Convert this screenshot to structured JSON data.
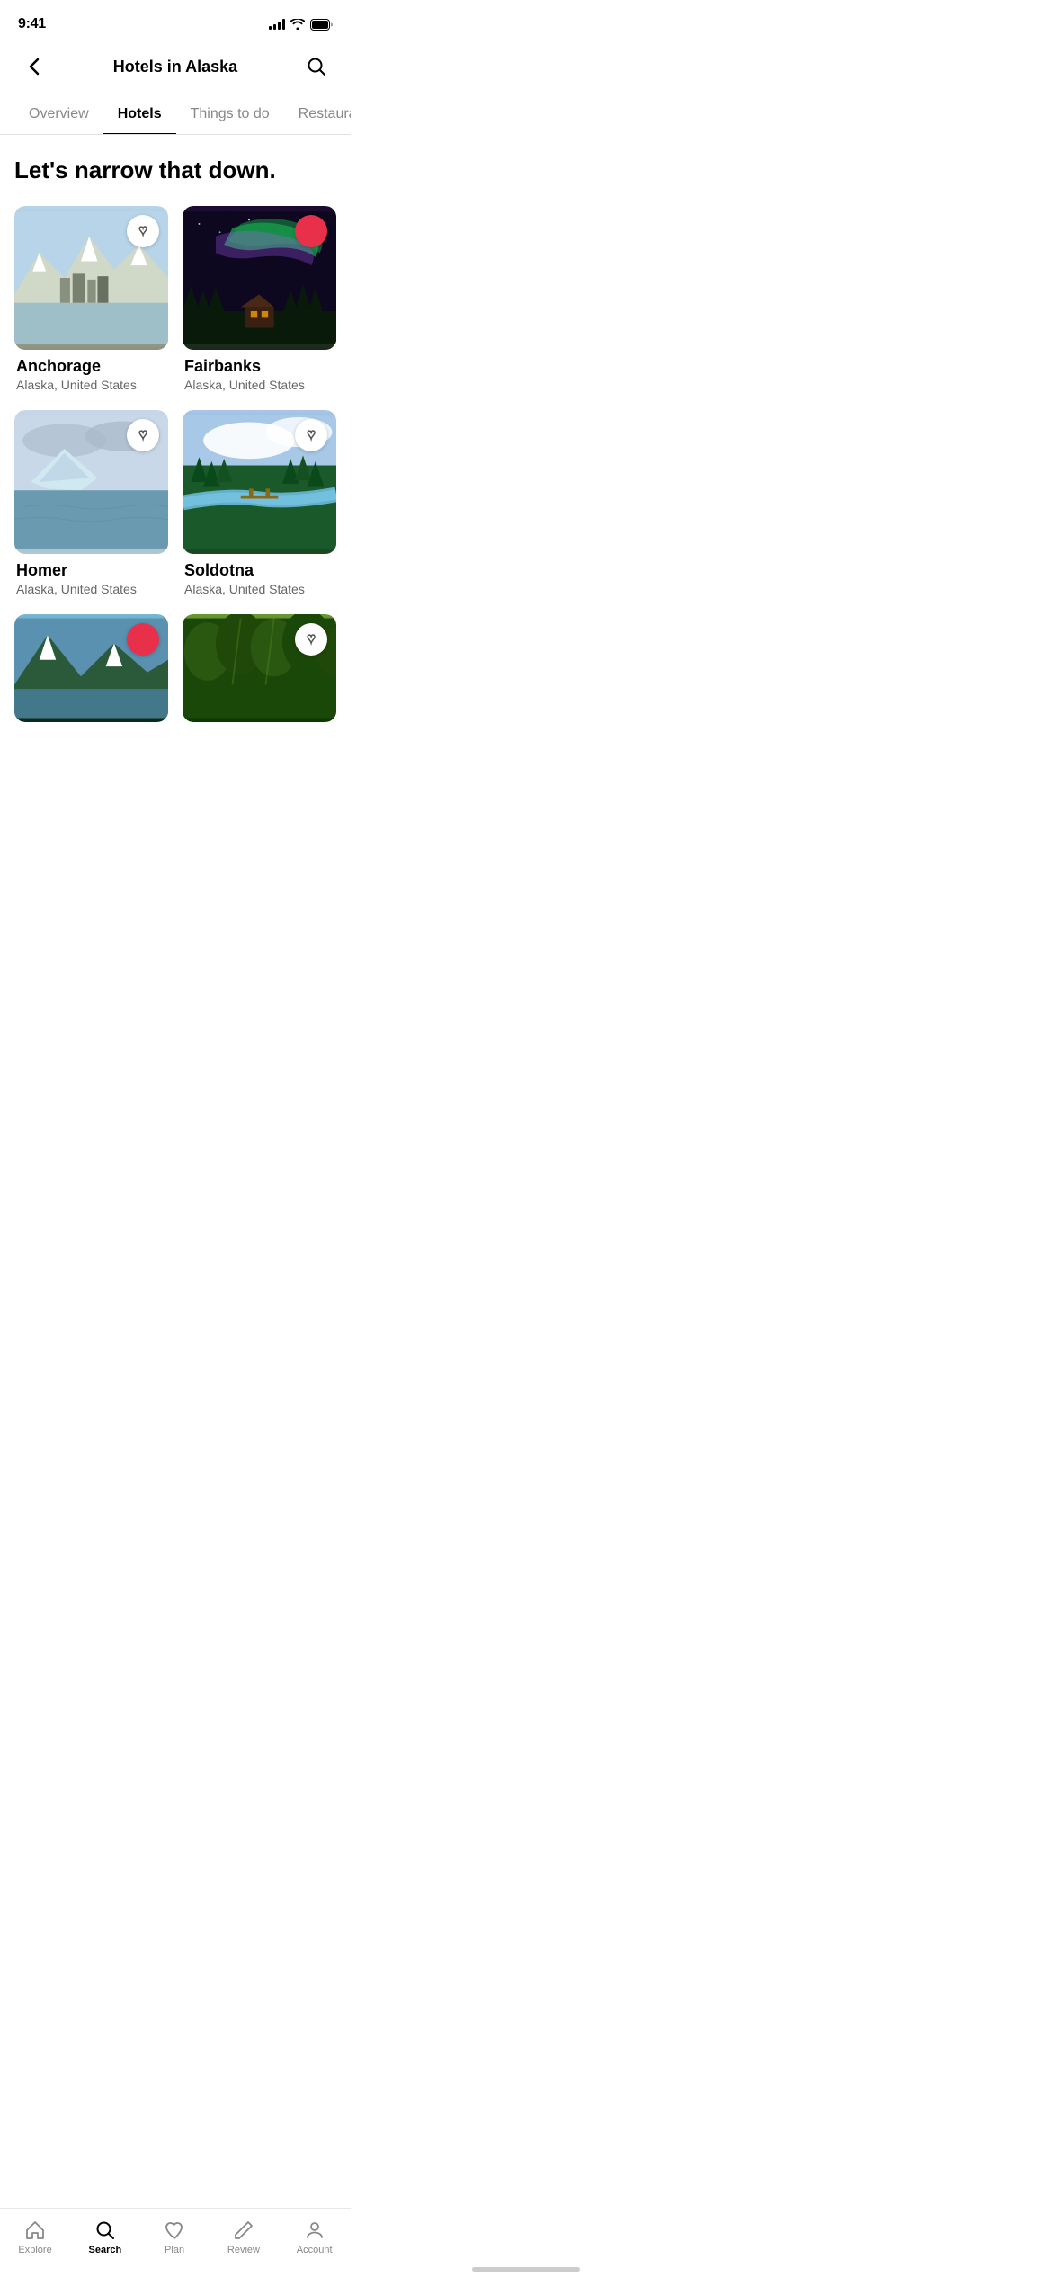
{
  "statusBar": {
    "time": "9:41",
    "timeIcon": "location-arrow-icon"
  },
  "header": {
    "backLabel": "‹",
    "title": "Hotels in Alaska",
    "searchIconLabel": "search"
  },
  "tabs": [
    {
      "id": "overview",
      "label": "Overview",
      "active": false
    },
    {
      "id": "hotels",
      "label": "Hotels",
      "active": true
    },
    {
      "id": "things-to-do",
      "label": "Things to do",
      "active": false
    },
    {
      "id": "restaurants",
      "label": "Restaurants",
      "active": false
    }
  ],
  "sectionTitle": "Let's narrow that down.",
  "cards": [
    {
      "id": "anchorage",
      "name": "Anchorage",
      "location": "Alaska, United States",
      "favorited": false,
      "imageClass": "img-anchorage"
    },
    {
      "id": "fairbanks",
      "name": "Fairbanks",
      "location": "Alaska, United States",
      "favorited": true,
      "imageClass": "img-fairbanks"
    },
    {
      "id": "homer",
      "name": "Homer",
      "location": "Alaska, United States",
      "favorited": false,
      "imageClass": "img-homer"
    },
    {
      "id": "soldotna",
      "name": "Soldotna",
      "location": "Alaska, United States",
      "favorited": false,
      "imageClass": "img-soldotna"
    },
    {
      "id": "card5",
      "name": "",
      "location": "",
      "favorited": true,
      "imageClass": "img-card5"
    },
    {
      "id": "card6",
      "name": "",
      "location": "",
      "favorited": false,
      "imageClass": "img-card6"
    }
  ],
  "bottomNav": [
    {
      "id": "explore",
      "label": "Explore",
      "icon": "home-icon",
      "active": false
    },
    {
      "id": "search",
      "label": "Search",
      "icon": "search-icon",
      "active": true
    },
    {
      "id": "plan",
      "label": "Plan",
      "icon": "heart-nav-icon",
      "active": false
    },
    {
      "id": "review",
      "label": "Review",
      "icon": "pencil-icon",
      "active": false
    },
    {
      "id": "account",
      "label": "Account",
      "icon": "person-icon",
      "active": false
    }
  ]
}
